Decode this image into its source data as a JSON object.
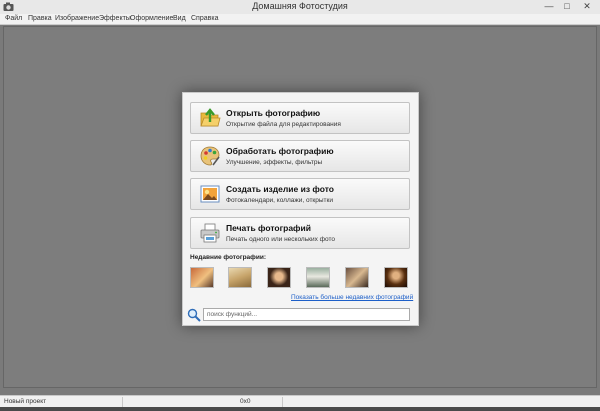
{
  "window": {
    "title": "Домашняя Фотостудия",
    "minimize_label": "—",
    "maximize_label": "□",
    "close_label": "✕"
  },
  "menu": [
    "Файл",
    "Правка",
    "Изображение",
    "Эффекты",
    "Оформление",
    "Вид",
    "Справка"
  ],
  "actions": [
    {
      "title": "Открыть фотографию",
      "description": "Открытие файла для редактирования",
      "icon": "open-folder-icon"
    },
    {
      "title": "Обработать фотографию",
      "description": "Улучшение, эффекты, фильтры",
      "icon": "palette-icon"
    },
    {
      "title": "Создать изделие из фото",
      "description": "Фотокалендари, коллажи, открытки",
      "icon": "photo-frame-icon"
    },
    {
      "title": "Печать фотографий",
      "description": "Печать одного или нескольких фото",
      "icon": "printer-icon"
    }
  ],
  "recent": {
    "heading": "Недавние фотографии:",
    "thumbnails": [
      "photo-thumbnail",
      "photo-thumbnail",
      "photo-thumbnail",
      "photo-thumbnail",
      "photo-thumbnail",
      "photo-thumbnail"
    ],
    "more_link": "Показать больше недавних фотографий"
  },
  "search": {
    "placeholder": "поиск функций..."
  },
  "status": {
    "project": "Новый проект",
    "size": "0x0"
  },
  "colors": {
    "workspace": "#7d7d7d",
    "panel": "#f4f4f4",
    "link": "#1d5fc8"
  }
}
